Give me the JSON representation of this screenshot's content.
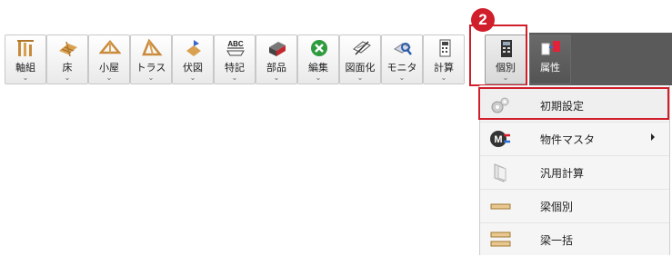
{
  "step_badge": "2",
  "ribbon": {
    "buttons": [
      {
        "label": "軸組",
        "icon": "frame-icon"
      },
      {
        "label": "床",
        "icon": "floor-icon"
      },
      {
        "label": "小屋",
        "icon": "roof-truss-icon"
      },
      {
        "label": "トラス",
        "icon": "truss-icon"
      },
      {
        "label": "伏図",
        "icon": "floor-plan-icon"
      },
      {
        "label": "特記",
        "icon": "abc-note-icon"
      },
      {
        "label": "部品",
        "icon": "parts-icon"
      },
      {
        "label": "編集",
        "icon": "edit-tools-icon"
      },
      {
        "label": "図面化",
        "icon": "drawing-icon"
      },
      {
        "label": "モニタ",
        "icon": "monitor-icon"
      },
      {
        "label": "計算",
        "icon": "calculation-icon"
      },
      {
        "label": "個別",
        "icon": "individual-calc-icon"
      },
      {
        "label": "属性",
        "icon": "attribute-icon"
      }
    ],
    "chevron": "⌄",
    "icon_text_abc": "ABC"
  },
  "menu": {
    "items": [
      {
        "label": "初期設定",
        "icon": "gears-icon",
        "highlighted": true
      },
      {
        "label": "物件マスタ",
        "icon": "master-icon",
        "submenu": true
      },
      {
        "label": "汎用計算",
        "icon": "general-calc-icon"
      },
      {
        "label": "梁個別",
        "icon": "beam-icon"
      },
      {
        "label": "梁一括",
        "icon": "beam-batch-icon"
      }
    ]
  },
  "colors": {
    "accent_red": "#d01e2a",
    "ribbon_dark": "#5a5a5a",
    "menu_bg": "#f5f5f5"
  }
}
